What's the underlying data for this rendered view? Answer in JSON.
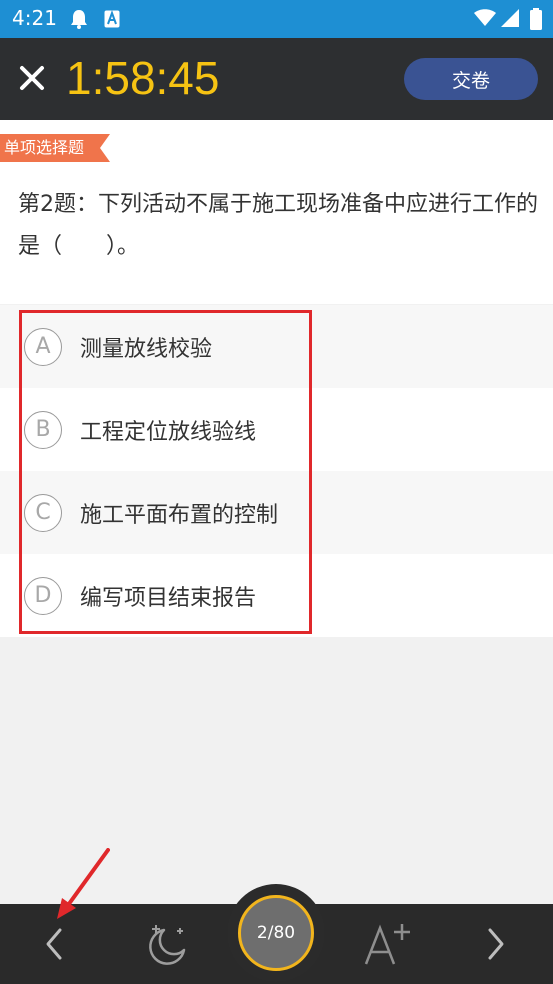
{
  "status_bar": {
    "time": "4:21",
    "icons": [
      "bell-icon",
      "notification-a-icon",
      "wifi-icon",
      "signal-icon",
      "battery-icon"
    ]
  },
  "header": {
    "timer": "1:58:45",
    "submit_label": "交卷",
    "close_icon": "close-icon"
  },
  "question": {
    "type_tag": "单项选择题",
    "text": "第2题：下列活动不属于施工现场准备中应进行工作的是（　　）。"
  },
  "options": [
    {
      "letter": "A",
      "text": "测量放线校验"
    },
    {
      "letter": "B",
      "text": "工程定位放线验线"
    },
    {
      "letter": "C",
      "text": "施工平面布置的控制"
    },
    {
      "letter": "D",
      "text": "编写项目结束报告"
    }
  ],
  "bottom_bar": {
    "progress": "2/80",
    "icons": [
      "chevron-left-icon",
      "night-mode-icon",
      "font-size-icon",
      "chevron-right-icon"
    ]
  },
  "colors": {
    "status_bar": "#1e8fd3",
    "header": "#2d2f31",
    "timer": "#f6c313",
    "submit_button": "#3a5393",
    "tag": "#f0744b",
    "highlight": "#e0282b",
    "progress_ring": "#f2b51d"
  }
}
